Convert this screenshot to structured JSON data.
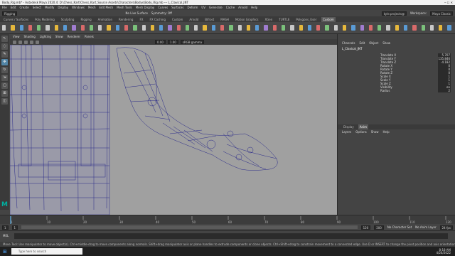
{
  "title_bar": {
    "text": "Body_Rig.mb* - Autodesk Maya 2020.4: D:\\Chess_Kart\\Chess_Kart_Source Assets\\Characters\\Bodys\\Body_Rig.mb --- L_Clavical_JNT"
  },
  "menus": [
    "File",
    "Edit",
    "Create",
    "Select",
    "Modify",
    "Display",
    "Windows",
    "Mesh",
    "Edit Mesh",
    "Mesh Tools",
    "Mesh Display",
    "Curves",
    "Surfaces",
    "Deform",
    "UV",
    "Generate",
    "Cache",
    "Arnold",
    "Help"
  ],
  "status_line": {
    "mode": "Rigging",
    "no_live": "No Live Surface",
    "symmetry": "Symmetry: Off",
    "user": "kyle.projects@",
    "workspace_label": "Workspace:",
    "workspace": "Maya Classic"
  },
  "shelf_tabs": [
    "Curves / Surfaces",
    "Poly Modeling",
    "Sculpting",
    "Rigging",
    "Animation",
    "Rendering",
    "FX",
    "FX Caching",
    "Custom",
    "Arnold",
    "Bifrost",
    "MASH",
    "Motion Graphics",
    "XGen",
    "TURTLE",
    "Polygons_User",
    "Custom"
  ],
  "shelf_icon_colors": [
    "#c8c8c8",
    "#e6b83c",
    "#5a9bd5",
    "#d86a6a",
    "#7bc17b",
    "#c8c8c8",
    "#e6b83c",
    "#5a9bd5",
    "#a07cd0",
    "#d86a6a",
    "#7bc17b",
    "#c8c8c8",
    "#e6b83c",
    "#5a9bd5",
    "#d86a6a",
    "#7bc17b",
    "#c8c8c8",
    "#e6b83c",
    "#5a9bd5",
    "#a07cd0",
    "#d86a6a",
    "#7bc17b",
    "#c8c8c8",
    "#e6b83c",
    "#5a9bd5",
    "#d86a6a",
    "#7bc17b",
    "#c8c8c8",
    "#e6b83c",
    "#5a9bd5",
    "#a07cd0",
    "#d86a6a",
    "#7bc17b",
    "#c8c8c8",
    "#e6b83c",
    "#5a9bd5",
    "#d86a6a",
    "#7bc17b",
    "#c8c8c8",
    "#e6b83c",
    "#5a9bd5",
    "#a07cd0",
    "#d86a6a",
    "#7bc17b",
    "#c8c8c8",
    "#e6b83c",
    "#5a9bd5",
    "#d86a6a",
    "#7bc17b",
    "#c8c8c8",
    "#e6b83c",
    "#5a9bd5"
  ],
  "viewport": {
    "menus": [
      "View",
      "Shading",
      "Lighting",
      "Show",
      "Renderer",
      "Panels"
    ],
    "field1": "0.00",
    "field2": "1.00",
    "colorspace": "sRGB gamma",
    "bg_color": "#a0a0a0",
    "mesh_color": "#2a2a8a"
  },
  "channel_box": {
    "tabs": [
      "Channels",
      "Edit",
      "Object",
      "Show"
    ],
    "node": "L_Clavical_JNT",
    "rows": [
      {
        "name": "Translate X",
        "value": "5.707"
      },
      {
        "name": "Translate Y",
        "value": "135.846"
      },
      {
        "name": "Translate Z",
        "value": "-4.182"
      },
      {
        "name": "Rotate X",
        "value": "0"
      },
      {
        "name": "Rotate Y",
        "value": "0"
      },
      {
        "name": "Rotate Z",
        "value": "0"
      },
      {
        "name": "Scale X",
        "value": "1"
      },
      {
        "name": "Scale Y",
        "value": "1"
      },
      {
        "name": "Scale Z",
        "value": "1"
      },
      {
        "name": "Visibility",
        "value": "on"
      },
      {
        "name": "Radius",
        "value": "2"
      }
    ]
  },
  "layers": {
    "tabs": [
      "Display",
      "Anim"
    ],
    "menus": [
      "Layers",
      "Options",
      "Show",
      "Help"
    ]
  },
  "time_slider": {
    "ticks": [
      "1",
      "10",
      "20",
      "30",
      "40",
      "50",
      "60",
      "70",
      "80",
      "90",
      "100",
      "110",
      "120"
    ],
    "current": "1"
  },
  "range": {
    "start": "1",
    "inner_start": "1",
    "inner_end": "120",
    "end": "200",
    "character": "No Character Set",
    "anim_layer": "No Anim Layer",
    "fps": "24 fps"
  },
  "cmd": {
    "label": "MEL"
  },
  "help_line": "Move Tool: Use manipulator to move object(s). Ctrl+middle-drag to move components along normals. Shift+drag manipulator axis or plane handles to extrude components or clone objects. Ctrl+Shift+drag to constrain movement to a connected edge. Use D or INSERT to change the pivot position and axis orientation.",
  "taskbar": {
    "search": "Type here to search",
    "time": "8:18 AM",
    "date": "4/26/2022"
  },
  "logo": "M"
}
